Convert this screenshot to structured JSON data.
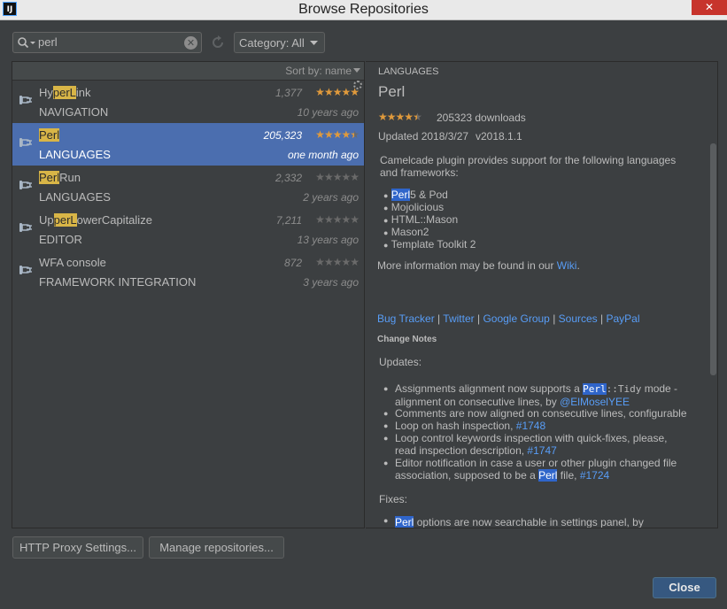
{
  "window": {
    "title": "Browse Repositories",
    "app_icon": "IJ",
    "close_glyph": "✕"
  },
  "toolbar": {
    "search_value": "perl",
    "clear_glyph": "✕",
    "category_label": "Category: All"
  },
  "list": {
    "sort_label": "Sort by: name",
    "plugins": [
      {
        "name_parts": [
          "Hy",
          "perL",
          "ink"
        ],
        "category": "NAVIGATION",
        "downloads": "1,377",
        "rating": 5,
        "age": "10 years ago",
        "selected": false
      },
      {
        "name_parts": [
          "",
          "Perl",
          ""
        ],
        "category": "LANGUAGES",
        "downloads": "205,323",
        "rating": 4.5,
        "age": "one month ago",
        "selected": true
      },
      {
        "name_parts": [
          "",
          "Perl",
          "Run"
        ],
        "category": "LANGUAGES",
        "downloads": "2,332",
        "rating": 0,
        "age": "2 years ago",
        "selected": false
      },
      {
        "name_parts": [
          "Up",
          "perL",
          "owerCapitalize"
        ],
        "category": "EDITOR",
        "downloads": "7,211",
        "rating": 0,
        "age": "13 years ago",
        "selected": false
      },
      {
        "name_parts": [
          "WFA console",
          "",
          ""
        ],
        "category": "FRAMEWORK INTEGRATION",
        "downloads": "872",
        "rating": 0,
        "age": "3 years ago",
        "selected": false
      }
    ]
  },
  "detail": {
    "category": "LANGUAGES",
    "name": "Perl",
    "rating": 4.5,
    "downloads": "205323 downloads",
    "updated": "Updated 2018/3/27",
    "version": "v2018.1.1",
    "description_line1": "Camelcade plugin provides support for the following languages",
    "description_line2": "and frameworks:",
    "features": [
      {
        "sel": "Perl",
        "rest": "5 & Pod"
      },
      {
        "sel": "",
        "rest": "Mojolicious"
      },
      {
        "sel": "",
        "rest": "HTML::Mason"
      },
      {
        "sel": "",
        "rest": "Mason2"
      },
      {
        "sel": "",
        "rest": "Template Toolkit 2"
      }
    ],
    "more_info_text": "More information may be found in our",
    "more_info_link": "Wiki",
    "more_info_end": ".",
    "links": [
      "Bug Tracker",
      "Twitter",
      "Google Group",
      "Sources",
      "PayPal"
    ],
    "link_separator": "|",
    "change_notes_heading": "Change Notes",
    "updates_heading": "Updates:",
    "updates": [
      {
        "a": "Assignments alignment now supports a",
        "sel": "Perl",
        "mono": "::Tidy",
        "b": "mode -",
        "line2": "alignment on consecutive lines, by",
        "link": "@ElMoselYEE"
      },
      {
        "a": "Comments are now aligned on consecutive lines, configurable"
      },
      {
        "a": "Loop on hash inspection,",
        "link": "#1748"
      },
      {
        "a": "Loop control keywords inspection with quick-fixes, please,",
        "line2": "read inspection description,",
        "link": "#1747"
      },
      {
        "a": "Editor notification in case a user or other plugin changed file",
        "line2": "association, supposed to be a",
        "sel": "Perl",
        "b": "file,",
        "link": "#1724"
      }
    ],
    "fixes_heading": "Fixes:",
    "fixes_first": {
      "sel": "Perl",
      "rest": "options are now searchable in settings panel, by"
    },
    "bullet": "●"
  },
  "buttons": {
    "http_proxy": "HTTP Proxy Settings...",
    "manage_repos": "Manage repositories...",
    "close": "Close"
  },
  "colors": {
    "accent": "#4b6eaf",
    "link": "#589df6",
    "highlight": "#d8b547",
    "star": "#e09a3c"
  }
}
